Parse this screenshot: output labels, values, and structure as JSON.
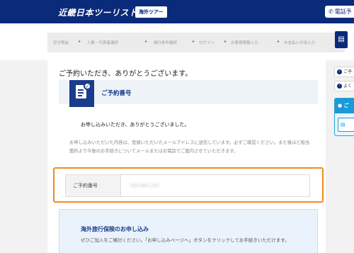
{
  "header": {
    "logo": "近畿日本ツーリスト",
    "badge": "海外ツアー",
    "phone_button": "電話予"
  },
  "steps": [
    "空き照会",
    "人数・代表者選択",
    "旅行条件確認",
    "ログイン",
    "お客様情報入力",
    "お支払い方法入力"
  ],
  "page_title": "ご予約いただき、ありがとうございます。",
  "reservation": {
    "heading": "ご予約番号",
    "thanks": "お申し込みいただき、ありがとうございました。",
    "notice": "お申し込みいただいた内容は、登録いただいたメールアドレスに送信しています。必ずご確認ください。また後ほど担当箇所より今後のお手続きについてメールまたはお電話でご案内させていただきます。",
    "number_label": "ご予約番号",
    "number_value": "790-685-235"
  },
  "insurance": {
    "title": "海外旅行保険のお申し込み",
    "text": "ぜひご加入をご検討ください。「お申し込みページへ」ボタンをクリックしてお手続きいただけます。"
  },
  "side": {
    "item1": "ご予",
    "item2": "よく",
    "panel_head": "ご"
  },
  "colors": {
    "header": "#0a2a7a",
    "highlight": "#f08a1a",
    "accent": "#1a3c8c"
  }
}
